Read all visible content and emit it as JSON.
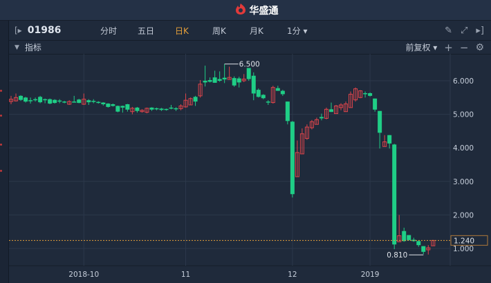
{
  "header": {
    "brand": "华盛通",
    "logo_icon": "fire-logo-icon"
  },
  "toolbar": {
    "code": "01986",
    "tabs": [
      {
        "label": "分时"
      },
      {
        "label": "五日"
      },
      {
        "label": "日K",
        "active": true
      },
      {
        "label": "周K"
      },
      {
        "label": "月K"
      },
      {
        "label": "1分 ▾"
      }
    ]
  },
  "indicator": {
    "label": "指标",
    "adjust": "前复权 ▾",
    "plus": "+",
    "minus": "−"
  },
  "colors": {
    "up": "#e0454b",
    "down": "#1fce86",
    "bg": "#1f2a3b",
    "accent": "#e8a13a"
  },
  "chart_data": {
    "type": "candlestick",
    "yticks": [
      "6.000",
      "5.000",
      "4.000",
      "3.000",
      "2.000",
      "1.000"
    ],
    "ytick_values": [
      6,
      5,
      4,
      3,
      2,
      1
    ],
    "ylim": [
      0.5,
      6.8
    ],
    "xticks": [
      {
        "label": "2018-10",
        "index": 15
      },
      {
        "label": "11",
        "index": 36
      },
      {
        "label": "12",
        "index": 58
      },
      {
        "label": "2019",
        "index": 74
      }
    ],
    "high_label": {
      "text": "6.500",
      "index": 44,
      "value": 6.5
    },
    "low_label": {
      "text": "0.810",
      "index": 85,
      "value": 0.81
    },
    "last_price": {
      "text": "1.240",
      "value": 1.24
    },
    "ohlc": [
      [
        5.38,
        5.55,
        5.3,
        5.45
      ],
      [
        5.4,
        5.62,
        5.38,
        5.5
      ],
      [
        5.55,
        5.57,
        5.4,
        5.43
      ],
      [
        5.5,
        5.52,
        5.35,
        5.38
      ],
      [
        5.42,
        5.5,
        5.32,
        5.41
      ],
      [
        5.45,
        5.5,
        5.38,
        5.44
      ],
      [
        5.52,
        5.55,
        5.33,
        5.36
      ],
      [
        5.45,
        5.47,
        5.33,
        5.42
      ],
      [
        5.45,
        5.47,
        5.3,
        5.32
      ],
      [
        5.43,
        5.45,
        5.32,
        5.34
      ],
      [
        5.41,
        5.45,
        5.33,
        5.38
      ],
      [
        5.38,
        5.4,
        5.33,
        5.36
      ],
      [
        5.3,
        5.42,
        5.28,
        5.38
      ],
      [
        5.38,
        5.55,
        5.35,
        5.37
      ],
      [
        5.44,
        5.46,
        5.33,
        5.34
      ],
      [
        5.3,
        5.62,
        5.28,
        5.45
      ],
      [
        5.42,
        5.45,
        5.28,
        5.36
      ],
      [
        5.4,
        5.45,
        5.33,
        5.37
      ],
      [
        5.37,
        5.39,
        5.32,
        5.34
      ],
      [
        5.35,
        5.36,
        5.26,
        5.3
      ],
      [
        5.32,
        5.33,
        5.2,
        5.22
      ],
      [
        5.3,
        5.32,
        5.23,
        5.25
      ],
      [
        5.25,
        5.26,
        5.06,
        5.08
      ],
      [
        5.25,
        5.26,
        5.05,
        5.2
      ],
      [
        5.3,
        5.31,
        5.08,
        5.14
      ],
      [
        5.08,
        5.22,
        5.0,
        5.18
      ],
      [
        5.2,
        5.22,
        5.05,
        5.1
      ],
      [
        5.08,
        5.15,
        5.05,
        5.12
      ],
      [
        5.06,
        5.2,
        5.03,
        5.18
      ],
      [
        5.2,
        5.21,
        5.1,
        5.14
      ],
      [
        5.18,
        5.2,
        5.12,
        5.15
      ],
      [
        5.17,
        5.19,
        5.1,
        5.13
      ],
      [
        5.16,
        5.17,
        5.11,
        5.15
      ],
      [
        5.2,
        5.28,
        5.15,
        5.18
      ],
      [
        5.18,
        5.21,
        5.1,
        5.15
      ],
      [
        5.17,
        5.3,
        5.12,
        5.25
      ],
      [
        5.22,
        5.62,
        5.2,
        5.42
      ],
      [
        5.28,
        5.5,
        5.27,
        5.47
      ],
      [
        5.52,
        5.55,
        5.25,
        5.38
      ],
      [
        5.55,
        6.02,
        5.5,
        5.9
      ],
      [
        6.0,
        6.45,
        5.83,
        5.95
      ],
      [
        6.02,
        6.1,
        5.95,
        5.97
      ],
      [
        6.1,
        6.3,
        5.94,
        5.94
      ],
      [
        6.05,
        6.28,
        5.97,
        6.0
      ],
      [
        6.09,
        6.5,
        5.93,
        6.04
      ],
      [
        6.04,
        6.42,
        6.04,
        6.1
      ],
      [
        6.08,
        6.13,
        5.82,
        5.86
      ],
      [
        6.07,
        6.12,
        5.8,
        5.95
      ],
      [
        6.0,
        6.2,
        5.96,
        6.05
      ],
      [
        6.38,
        6.38,
        6.0,
        6.05
      ],
      [
        6.15,
        6.25,
        5.42,
        5.62
      ],
      [
        5.73,
        5.77,
        5.5,
        5.52
      ],
      [
        5.58,
        5.6,
        5.45,
        5.48
      ],
      [
        5.38,
        5.42,
        5.28,
        5.35
      ],
      [
        5.35,
        5.85,
        5.32,
        5.8
      ],
      [
        5.78,
        5.85,
        5.7,
        5.7
      ],
      [
        5.7,
        5.73,
        5.55,
        5.6
      ],
      [
        5.38,
        5.38,
        4.7,
        4.8
      ],
      [
        4.78,
        4.8,
        2.52,
        2.62
      ],
      [
        3.14,
        4.22,
        3.14,
        3.86
      ],
      [
        3.82,
        4.58,
        3.82,
        4.42
      ],
      [
        4.28,
        4.7,
        4.24,
        4.62
      ],
      [
        4.6,
        4.83,
        4.55,
        4.78
      ],
      [
        4.7,
        4.9,
        4.7,
        4.84
      ],
      [
        4.92,
        5.02,
        4.82,
        4.88
      ],
      [
        4.88,
        5.2,
        4.85,
        5.15
      ],
      [
        5.15,
        5.35,
        5.07,
        5.07
      ],
      [
        5.02,
        5.28,
        5.02,
        5.25
      ],
      [
        5.2,
        5.33,
        5.12,
        5.28
      ],
      [
        5.08,
        5.38,
        5.08,
        5.31
      ],
      [
        5.2,
        5.68,
        5.2,
        5.6
      ],
      [
        5.43,
        5.8,
        5.38,
        5.76
      ],
      [
        5.5,
        5.72,
        5.48,
        5.7
      ],
      [
        5.63,
        5.68,
        5.5,
        5.6
      ],
      [
        5.63,
        5.65,
        5.53,
        5.55
      ],
      [
        5.47,
        5.47,
        5.08,
        5.14
      ],
      [
        5.1,
        5.1,
        3.98,
        4.45
      ],
      [
        4.04,
        4.38,
        4.04,
        4.18
      ],
      [
        4.38,
        4.38,
        3.98,
        4.13
      ],
      [
        4.1,
        4.12,
        0.98,
        1.12
      ],
      [
        1.2,
        2.0,
        1.2,
        1.38
      ],
      [
        1.52,
        1.62,
        1.2,
        1.22
      ],
      [
        1.4,
        1.4,
        1.24,
        1.25
      ],
      [
        1.26,
        1.32,
        1.2,
        1.22
      ],
      [
        1.22,
        1.24,
        1.05,
        1.1
      ],
      [
        1.07,
        1.07,
        0.83,
        0.9
      ],
      [
        0.96,
        1.1,
        0.82,
        1.02
      ],
      [
        1.08,
        1.25,
        1.08,
        1.24
      ]
    ]
  }
}
